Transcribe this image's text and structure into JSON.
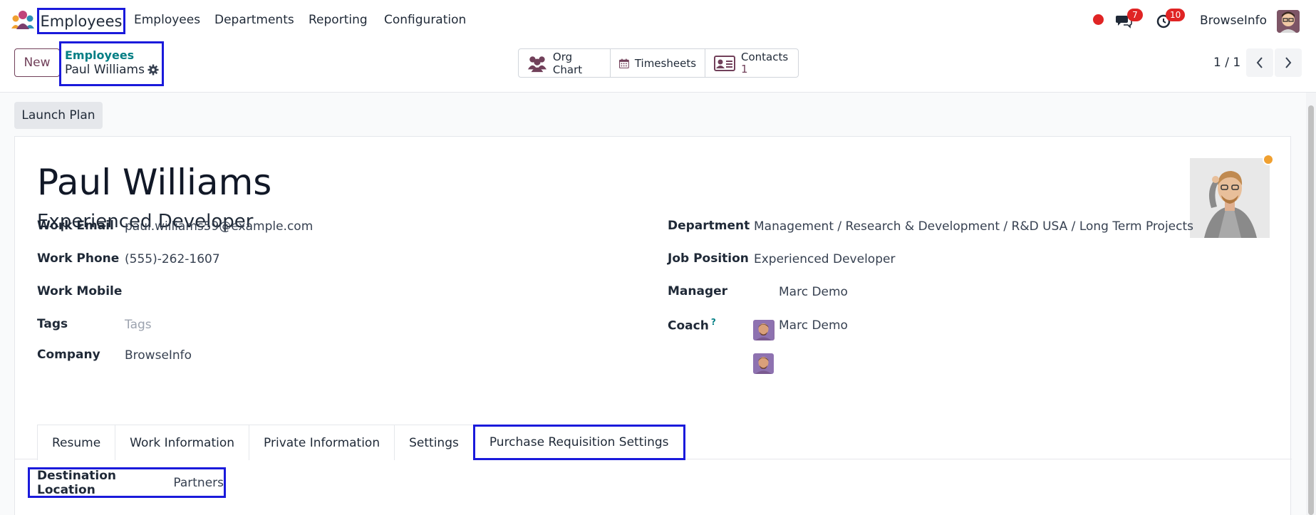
{
  "navbar": {
    "app_title": "Employees",
    "menu": [
      "Employees",
      "Departments",
      "Reporting",
      "Configuration"
    ],
    "messages_count": "7",
    "activities_count": "10",
    "company": "BrowseInfo"
  },
  "control_panel": {
    "new_label": "New",
    "breadcrumb_parent": "Employees",
    "breadcrumb_current": "Paul Williams",
    "smart_buttons": {
      "org_chart": "Org Chart",
      "timesheets": "Timesheets",
      "contacts": "Contacts",
      "contacts_count": "1"
    },
    "pager": "1 / 1"
  },
  "actions": {
    "launch_plan": "Launch Plan"
  },
  "employee": {
    "name": "Paul Williams",
    "job_title": "Experienced Developer",
    "left_fields": {
      "work_email_label": "Work Email",
      "work_email": "paul.williams59@example.com",
      "work_phone_label": "Work Phone",
      "work_phone": "(555)-262-1607",
      "work_mobile_label": "Work Mobile",
      "work_mobile": "",
      "tags_label": "Tags",
      "tags_placeholder": "Tags",
      "company_label": "Company",
      "company": "BrowseInfo"
    },
    "right_fields": {
      "department_label": "Department",
      "department": "Management / Research & Development / R&D USA / Long Term Projects",
      "job_position_label": "Job Position",
      "job_position": "Experienced Developer",
      "manager_label": "Manager",
      "manager": "Marc Demo",
      "coach_label": "Coach",
      "coach_help": "?",
      "coach": "Marc Demo"
    }
  },
  "tabs": [
    "Resume",
    "Work Information",
    "Private Information",
    "Settings",
    "Purchase Requisition Settings"
  ],
  "purchase_requisition": {
    "destination_label": "Destination Location",
    "destination_value": "Partners"
  },
  "colors": {
    "primary": "#71405a",
    "link": "#017e84",
    "highlight_box": "#1a1adb",
    "badge": "#e02424",
    "status_dot": "#f0a030"
  }
}
